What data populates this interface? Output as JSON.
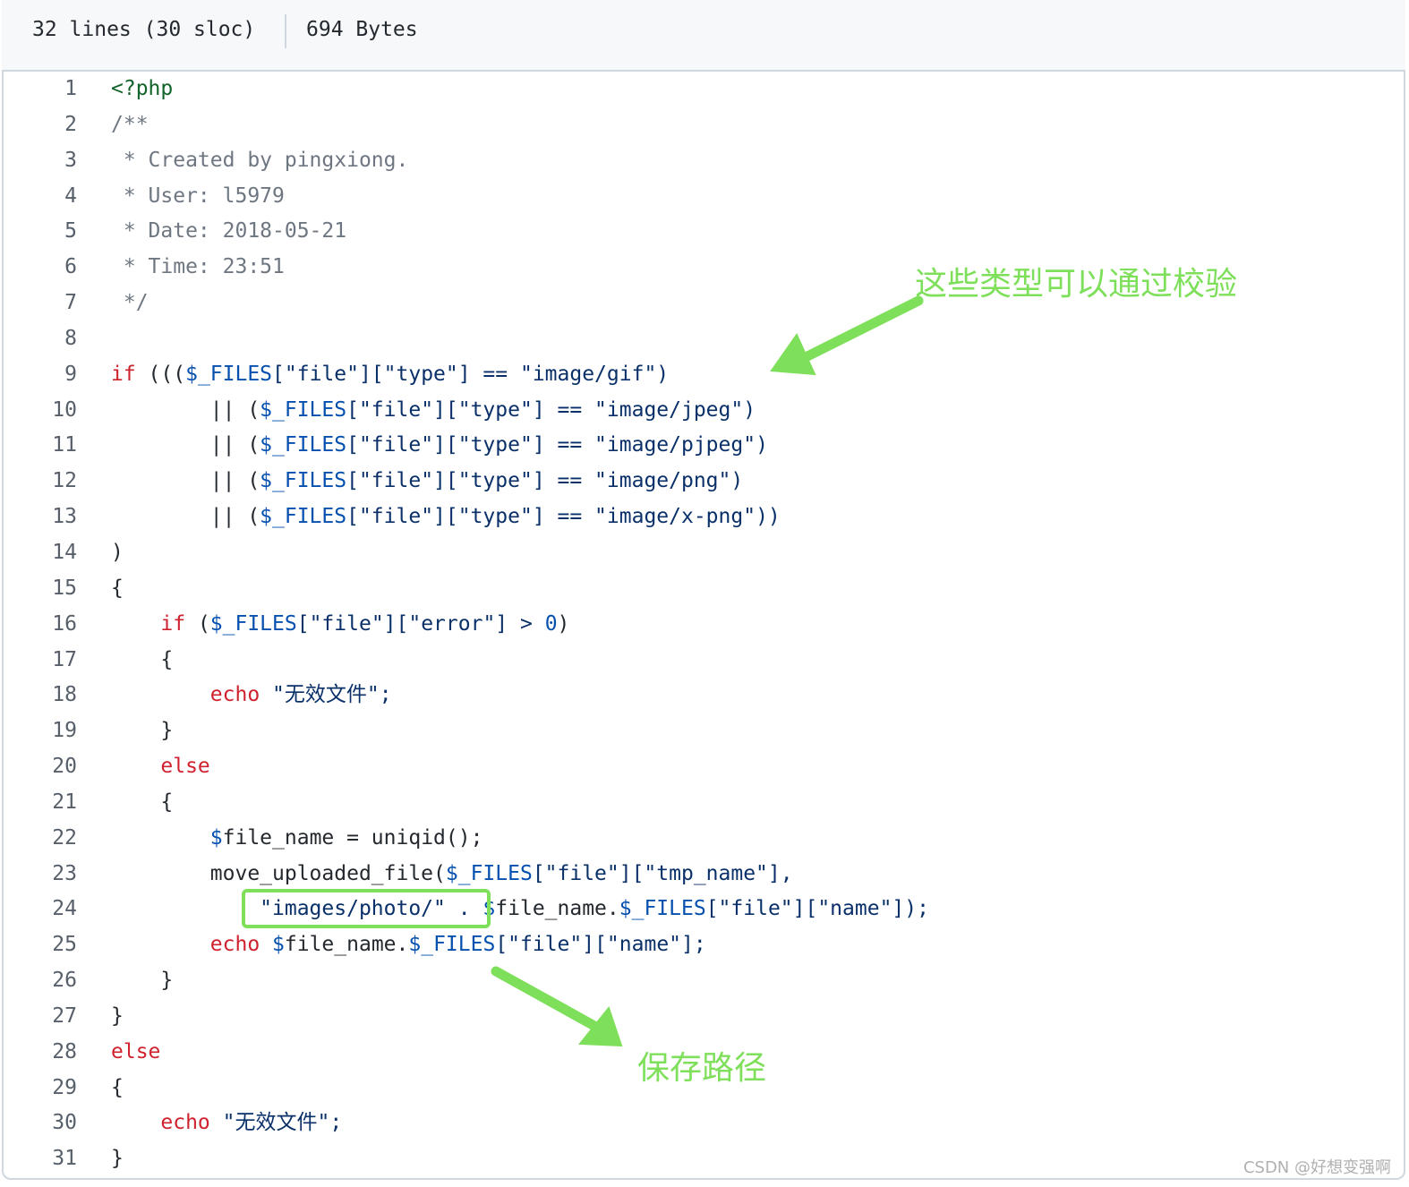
{
  "file_header": {
    "lines_info": "32 lines (30 sloc)",
    "size": "694 Bytes"
  },
  "code_lines": [
    {
      "n": "1",
      "segs": [
        {
          "t": "<?php",
          "c": "pt"
        }
      ]
    },
    {
      "n": "2",
      "segs": [
        {
          "t": "/**",
          "c": "cm"
        }
      ]
    },
    {
      "n": "3",
      "segs": [
        {
          "t": " * Created by pingxiong.",
          "c": "cm"
        }
      ]
    },
    {
      "n": "4",
      "segs": [
        {
          "t": " * User: l5979",
          "c": "cm"
        }
      ]
    },
    {
      "n": "5",
      "segs": [
        {
          "t": " * Date: 2018-05-21",
          "c": "cm"
        }
      ]
    },
    {
      "n": "6",
      "segs": [
        {
          "t": " * Time: 23:51",
          "c": "cm"
        }
      ]
    },
    {
      "n": "7",
      "segs": [
        {
          "t": " */",
          "c": "cm"
        }
      ]
    },
    {
      "n": "8",
      "segs": [
        {
          "t": "",
          "c": ""
        }
      ]
    },
    {
      "n": "9",
      "segs": [
        {
          "t": "if",
          "c": "kw"
        },
        {
          "t": " (((",
          "c": ""
        },
        {
          "t": "$_FILES",
          "c": "vr"
        },
        {
          "t": "[\"file\"][\"type\"] == \"image/gif\")",
          "c": "st"
        }
      ]
    },
    {
      "n": "10",
      "segs": [
        {
          "t": "        || (",
          "c": ""
        },
        {
          "t": "$_FILES",
          "c": "vr"
        },
        {
          "t": "[\"file\"][\"type\"] == \"image/jpeg\")",
          "c": "st"
        }
      ]
    },
    {
      "n": "11",
      "segs": [
        {
          "t": "        || (",
          "c": ""
        },
        {
          "t": "$_FILES",
          "c": "vr"
        },
        {
          "t": "[\"file\"][\"type\"] == \"image/pjpeg\")",
          "c": "st"
        }
      ]
    },
    {
      "n": "12",
      "segs": [
        {
          "t": "        || (",
          "c": ""
        },
        {
          "t": "$_FILES",
          "c": "vr"
        },
        {
          "t": "[\"file\"][\"type\"] == \"image/png\")",
          "c": "st"
        }
      ]
    },
    {
      "n": "13",
      "segs": [
        {
          "t": "        || (",
          "c": ""
        },
        {
          "t": "$_FILES",
          "c": "vr"
        },
        {
          "t": "[\"file\"][\"type\"] == \"image/x-png\"))",
          "c": "st"
        }
      ]
    },
    {
      "n": "14",
      "segs": [
        {
          "t": ")",
          "c": ""
        }
      ]
    },
    {
      "n": "15",
      "segs": [
        {
          "t": "{",
          "c": ""
        }
      ]
    },
    {
      "n": "16",
      "segs": [
        {
          "t": "    ",
          "c": ""
        },
        {
          "t": "if",
          "c": "kw"
        },
        {
          "t": " (",
          "c": ""
        },
        {
          "t": "$_FILES",
          "c": "vr"
        },
        {
          "t": "[\"file\"][\"error\"] > ",
          "c": "st"
        },
        {
          "t": "0",
          "c": "nm"
        },
        {
          "t": ")",
          "c": ""
        }
      ]
    },
    {
      "n": "17",
      "segs": [
        {
          "t": "    {",
          "c": ""
        }
      ]
    },
    {
      "n": "18",
      "segs": [
        {
          "t": "        ",
          "c": ""
        },
        {
          "t": "echo",
          "c": "kw"
        },
        {
          "t": " \"无效文件\";",
          "c": "st"
        }
      ]
    },
    {
      "n": "19",
      "segs": [
        {
          "t": "    }",
          "c": ""
        }
      ]
    },
    {
      "n": "20",
      "segs": [
        {
          "t": "    ",
          "c": ""
        },
        {
          "t": "else",
          "c": "kw"
        }
      ]
    },
    {
      "n": "21",
      "segs": [
        {
          "t": "    {",
          "c": ""
        }
      ]
    },
    {
      "n": "22",
      "segs": [
        {
          "t": "        ",
          "c": ""
        },
        {
          "t": "$",
          "c": "vr"
        },
        {
          "t": "file_name = uniqid();",
          "c": ""
        }
      ]
    },
    {
      "n": "23",
      "segs": [
        {
          "t": "        move_uploaded_file(",
          "c": ""
        },
        {
          "t": "$_FILES",
          "c": "vr"
        },
        {
          "t": "[\"file\"][\"tmp_name\"],",
          "c": "st"
        }
      ]
    },
    {
      "n": "24",
      "segs": [
        {
          "t": "            \"images/photo/\" . ",
          "c": "st"
        },
        {
          "t": "$",
          "c": "vr"
        },
        {
          "t": "file_name.",
          "c": ""
        },
        {
          "t": "$_FILES",
          "c": "vr"
        },
        {
          "t": "[\"file\"][\"name\"]);",
          "c": "st"
        }
      ]
    },
    {
      "n": "25",
      "segs": [
        {
          "t": "        ",
          "c": ""
        },
        {
          "t": "echo",
          "c": "kw"
        },
        {
          "t": " ",
          "c": ""
        },
        {
          "t": "$",
          "c": "vr"
        },
        {
          "t": "file_name.",
          "c": ""
        },
        {
          "t": "$_FILES",
          "c": "vr"
        },
        {
          "t": "[\"file\"][\"name\"];",
          "c": "st"
        }
      ]
    },
    {
      "n": "26",
      "segs": [
        {
          "t": "    }",
          "c": ""
        }
      ]
    },
    {
      "n": "27",
      "segs": [
        {
          "t": "}",
          "c": ""
        }
      ]
    },
    {
      "n": "28",
      "segs": [
        {
          "t": "else",
          "c": "kw"
        }
      ]
    },
    {
      "n": "29",
      "segs": [
        {
          "t": "{",
          "c": ""
        }
      ]
    },
    {
      "n": "30",
      "segs": [
        {
          "t": "    ",
          "c": ""
        },
        {
          "t": "echo",
          "c": "kw"
        },
        {
          "t": " \"无效文件\";",
          "c": "st"
        }
      ]
    },
    {
      "n": "31",
      "segs": [
        {
          "t": "}",
          "c": ""
        }
      ]
    }
  ],
  "annotations": {
    "type_check_note": "这些类型可以通过校验",
    "save_path_note": "保存路径",
    "accent_color": "#7ee05a"
  },
  "watermark": "CSDN @好想变强啊"
}
